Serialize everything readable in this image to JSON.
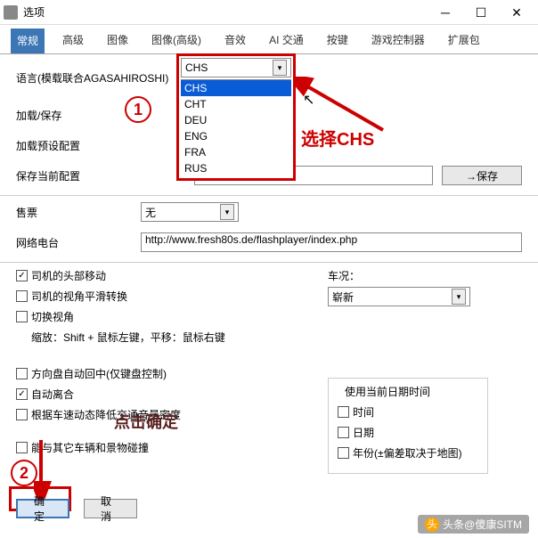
{
  "title": "选项",
  "tabs": [
    "常规",
    "高级",
    "图像",
    "图像(高级)",
    "音效",
    "AI 交通",
    "按键",
    "游戏控制器",
    "扩展包"
  ],
  "active_tab": "常规",
  "lang_label": "语言(模载联合AGASAHIROSHI)",
  "lang_value": "CHS",
  "lang_options": [
    "CHS",
    "CHT",
    "DEU",
    "ENG",
    "FRA",
    "RUS"
  ],
  "load_save": "加载/保存",
  "load_preset": "加载预设配置",
  "save_current": "保存当前配置",
  "save_btn": "→保存",
  "ticket_label": "售票",
  "ticket_value": "无",
  "radio_label": "网络电台",
  "radio_url": "http://www.fresh80s.de/flashplayer/index.php",
  "cb1": "司机的头部移动",
  "cb2": "司机的视角平滑转换",
  "cb3": "切换视角",
  "cb3_hint": "缩放：Shift + 鼠标左键，平移：鼠标右键",
  "cb4": "方向盘自动回中(仅键盘控制)",
  "cb5": "自动离合",
  "cb6": "根据车速动态降低交通音量密度",
  "cb7": "能与其它车辆和景物碰撞",
  "cond_label": "车况：",
  "cond_value": "崭新",
  "date_group": "使用当前日期时间",
  "date_time": "时间",
  "date_date": "日期",
  "date_year": "年份(±偏差取决于地图)",
  "ok": "确定",
  "cancel": "取消",
  "ann1": "1",
  "ann2": "2",
  "ann_select": "选择CHS",
  "ann_click": "点击确定",
  "watermark": "头条@傻康SITM"
}
